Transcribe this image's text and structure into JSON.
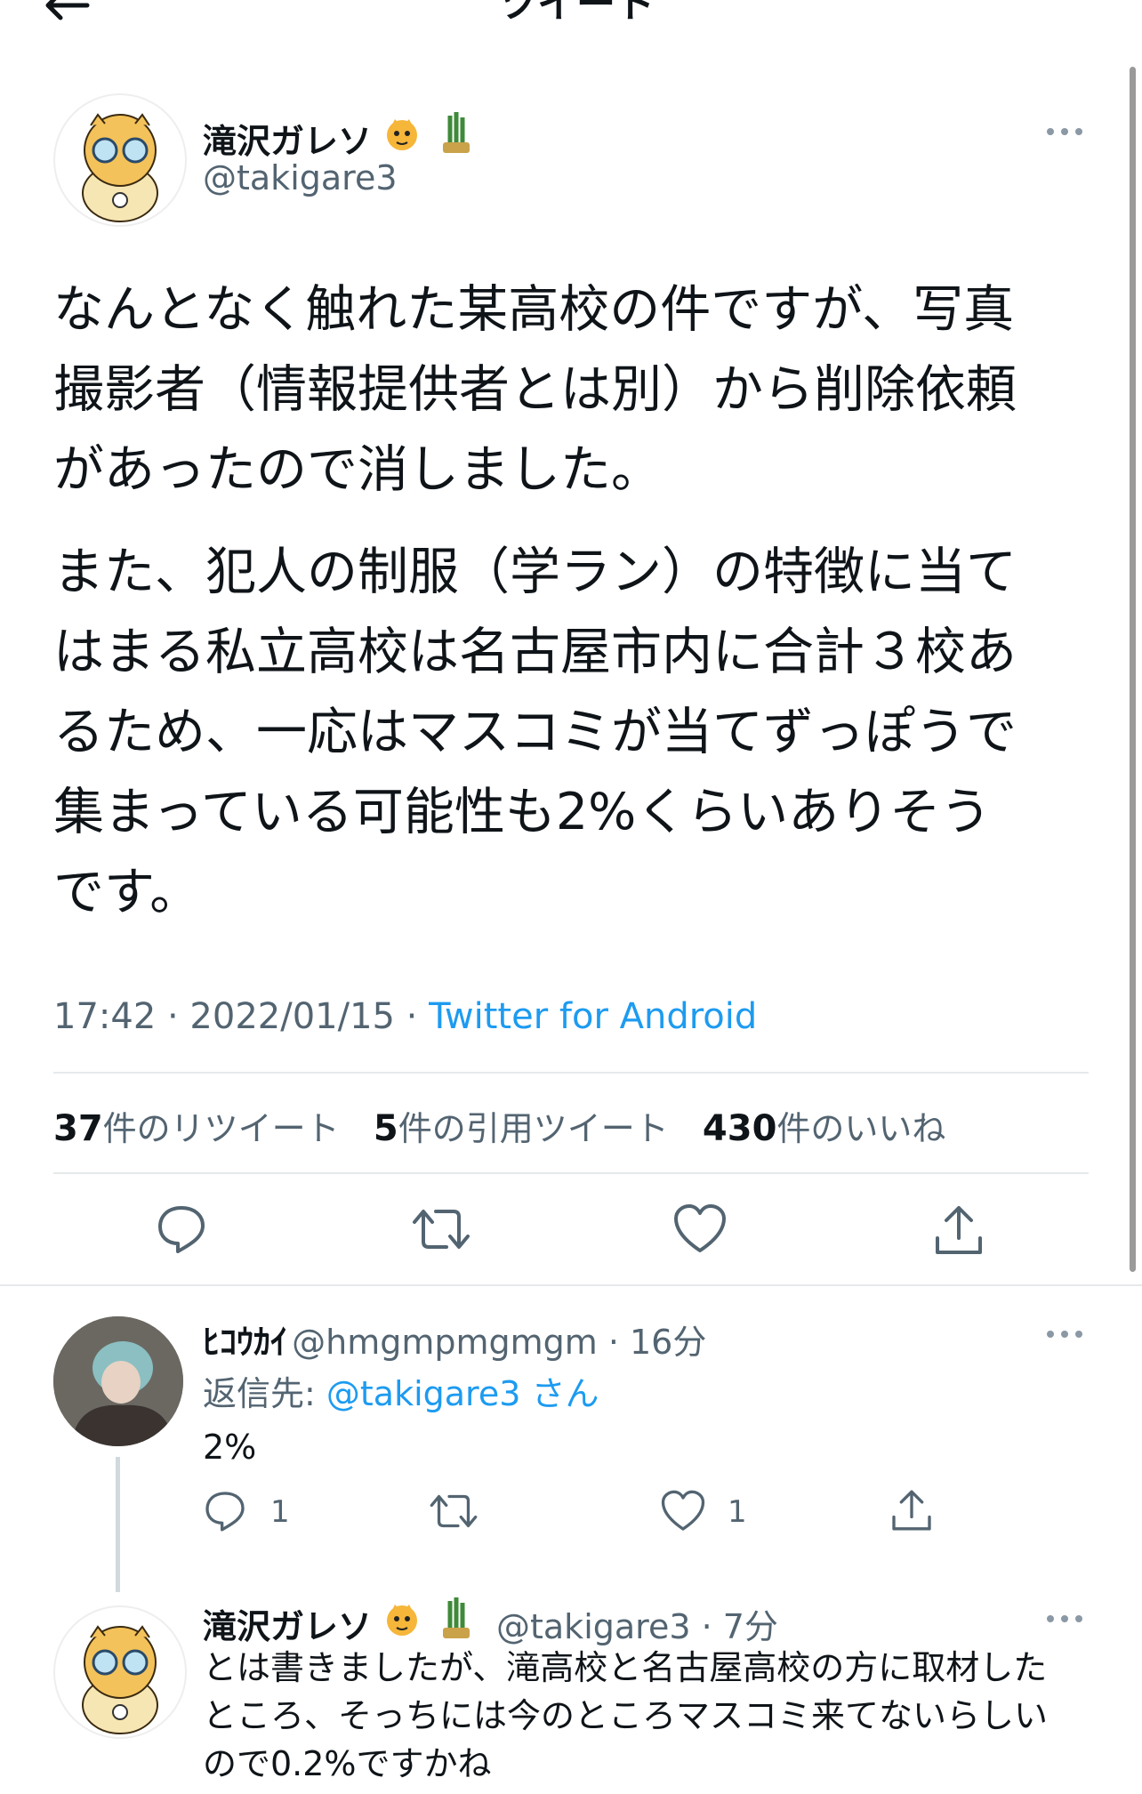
{
  "topbar": {
    "title": "ツイート"
  },
  "tweet": {
    "author_name": "滝沢ガレソ",
    "author_handle": "@takigare3",
    "body": [
      "なんとなく触れた某高校の件ですが、写真",
      "撮影者（情報提供者とは別）から削除依頼",
      "があったので消しました。"
    ],
    "body2": [
      "また、犯人の制服（学ラン）の特徴に当て",
      "はまる私立高校は名古屋市内に合計３校あ",
      "るため、一応はマスコミが当てずっぽうで",
      "集まっている可能性も2%くらいありそう",
      "です。"
    ],
    "time": "17:42 · 2022/01/15 · ",
    "source": "Twitter for Android",
    "stats": {
      "retweets_num": "37",
      "retweets_label": "件のリツイート",
      "quotes_num": "5",
      "quotes_label": "件の引用ツイート",
      "likes_num": "430",
      "likes_label": "件のいいね"
    }
  },
  "reply1": {
    "name": "ﾋｺｳｶｲ",
    "handle_time": "@hmgmpmgmgm · 16分",
    "reply_to_label": "返信先: ",
    "reply_to_user": "@takigare3",
    "reply_to_suffix": " さん",
    "text": "2%",
    "reply_count": "1",
    "like_count": "1"
  },
  "reply2": {
    "name": "滝沢ガレソ",
    "handle_time": "@takigare3 · 7分",
    "text": [
      "とは書きましたが、滝高校と名古屋高校の方に取材した",
      "ところ、そっちには今のところマスコミ来てないらしい",
      "ので0.2%ですかね"
    ]
  },
  "colors": {
    "accent": "#1d9bf0",
    "text": "#0f1419",
    "muted": "#536471",
    "divider": "#e6e9eb"
  },
  "icons": [
    "back-arrow-icon",
    "tiger-emoji-icon",
    "kadomatsu-icon",
    "more-icon",
    "reply-icon",
    "retweet-icon",
    "like-icon",
    "share-icon"
  ]
}
